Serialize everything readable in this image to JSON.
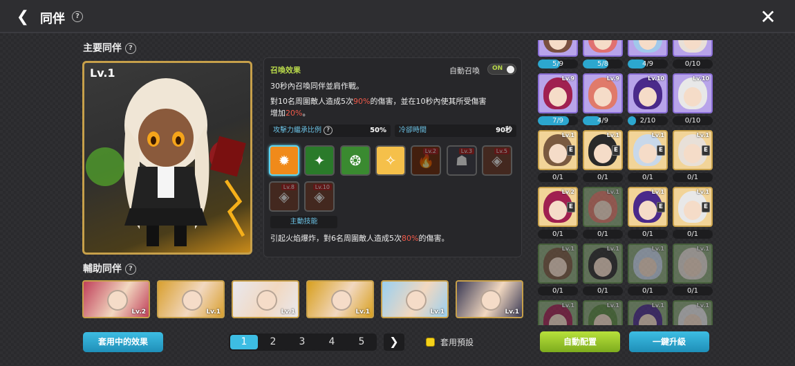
{
  "header": {
    "title": "同伴",
    "back_icon": "chevron-left-icon",
    "close_icon": "close-icon"
  },
  "main": {
    "section_title": "主要同伴",
    "portrait_level": "Lv.1",
    "summon_effect_label": "召喚效果",
    "auto_summon_label": "自動召喚",
    "auto_summon_toggle": "ON",
    "desc_line1": "30秒內召喚同伴並肩作戰。",
    "desc_line2_a": "對10名周圍敵人造成5次",
    "desc_line2_b": "90%",
    "desc_line2_c": "的傷害，並在10秒內使其所受傷害",
    "desc_line3_a": "增加",
    "desc_line3_b": "20%",
    "desc_line3_c": "。",
    "stat_attack_label": "攻擊力繼承比例",
    "stat_attack_value": "50%",
    "stat_cooldown_label": "冷卻時間",
    "stat_cooldown_value": "90秒",
    "skills": [
      {
        "icon": "fire-burst-icon",
        "level": "",
        "selected": true,
        "locked": false
      },
      {
        "icon": "green-leaf-icon",
        "level": "",
        "selected": false,
        "locked": false
      },
      {
        "icon": "green-rune-icon",
        "level": "",
        "selected": false,
        "locked": false
      },
      {
        "icon": "golden-figure-icon",
        "level": "",
        "selected": false,
        "locked": false
      },
      {
        "icon": "flame-field-icon",
        "level": "Lv.2",
        "selected": false,
        "locked": true
      },
      {
        "icon": "stand-figure-icon",
        "level": "Lv.3",
        "selected": false,
        "locked": true
      },
      {
        "icon": "fox-mask-icon",
        "level": "Lv.5",
        "selected": false,
        "locked": true
      },
      {
        "icon": "fox-mask-icon",
        "level": "Lv.8",
        "selected": false,
        "locked": true
      },
      {
        "icon": "fox-mask-icon",
        "level": "Lv.10",
        "selected": false,
        "locked": true
      }
    ],
    "active_skill_label": "主動技能",
    "active_desc_a": "引起火焰爆炸，對6名周圍敵人造成5次",
    "active_desc_b": "80%",
    "active_desc_c": "的傷害。"
  },
  "assist": {
    "title": "輔助同伴",
    "slots": [
      {
        "level": "Lv.2",
        "icon": "companion-portrait-icon"
      },
      {
        "level": "Lv.1",
        "icon": "companion-portrait-icon"
      },
      {
        "level": "Lv.1",
        "icon": "companion-portrait-icon"
      },
      {
        "level": "Lv.1",
        "icon": "companion-portrait-icon"
      },
      {
        "level": "Lv.1",
        "icon": "companion-portrait-icon"
      },
      {
        "level": "Lv.1",
        "icon": "companion-portrait-icon"
      }
    ]
  },
  "footer": {
    "effects_button": "套用中的效果",
    "pages": [
      "1",
      "2",
      "3",
      "4",
      "5"
    ],
    "active_page": "1",
    "next_icon": "chevron-right-icon",
    "preset_label": "套用預設",
    "auto_assign_button": "自動配置",
    "upgrade_all_button": "一鍵升級"
  },
  "companions": [
    {
      "level": "",
      "count": "5/9",
      "fill": 0.56,
      "tier": "purple",
      "e": false
    },
    {
      "level": "",
      "count": "5/8",
      "fill": 0.63,
      "tier": "purple",
      "e": false
    },
    {
      "level": "",
      "count": "4/9",
      "fill": 0.44,
      "tier": "purple",
      "e": false
    },
    {
      "level": "",
      "count": "0/10",
      "fill": 0,
      "tier": "purple",
      "e": false
    },
    {
      "level": "Lv.9",
      "count": "7/9",
      "fill": 0.78,
      "tier": "purple",
      "e": false
    },
    {
      "level": "Lv.9",
      "count": "4/9",
      "fill": 0.44,
      "tier": "purple",
      "e": false
    },
    {
      "level": "Lv.10",
      "count": "2/10",
      "fill": 0.2,
      "tier": "purple",
      "e": false
    },
    {
      "level": "Lv.10",
      "count": "0/10",
      "fill": 0,
      "tier": "purple",
      "e": false
    },
    {
      "level": "Lv.1",
      "count": "0/1",
      "fill": 0,
      "tier": "gold",
      "e": true
    },
    {
      "level": "Lv.1",
      "count": "0/1",
      "fill": 0,
      "tier": "gold",
      "e": true
    },
    {
      "level": "Lv.1",
      "count": "0/1",
      "fill": 0,
      "tier": "gold",
      "e": true
    },
    {
      "level": "Lv.1",
      "count": "0/1",
      "fill": 0,
      "tier": "gold",
      "e": true
    },
    {
      "level": "Lv.2",
      "count": "0/1",
      "fill": 0,
      "tier": "gold",
      "e": true
    },
    {
      "level": "Lv.1",
      "count": "0/1",
      "fill": 0,
      "tier": "green",
      "e": false
    },
    {
      "level": "Lv.1",
      "count": "0/1",
      "fill": 0,
      "tier": "gold",
      "e": true
    },
    {
      "level": "Lv.1",
      "count": "0/1",
      "fill": 0,
      "tier": "gold",
      "e": true
    },
    {
      "level": "Lv.1",
      "count": "0/1",
      "fill": 0,
      "tier": "green",
      "e": false
    },
    {
      "level": "Lv.1",
      "count": "0/1",
      "fill": 0,
      "tier": "green",
      "e": false
    },
    {
      "level": "Lv.1",
      "count": "0/1",
      "fill": 0,
      "tier": "green",
      "e": false
    },
    {
      "level": "Lv.1",
      "count": "0/1",
      "fill": 0,
      "tier": "green",
      "e": false
    },
    {
      "level": "Lv.1",
      "count": "",
      "fill": 0,
      "tier": "green",
      "e": false
    },
    {
      "level": "Lv.1",
      "count": "",
      "fill": 0,
      "tier": "green",
      "e": false
    },
    {
      "level": "Lv.1",
      "count": "",
      "fill": 0,
      "tier": "green",
      "e": false
    },
    {
      "level": "Lv.1",
      "count": "",
      "fill": 0,
      "tier": "green",
      "e": false
    }
  ]
}
